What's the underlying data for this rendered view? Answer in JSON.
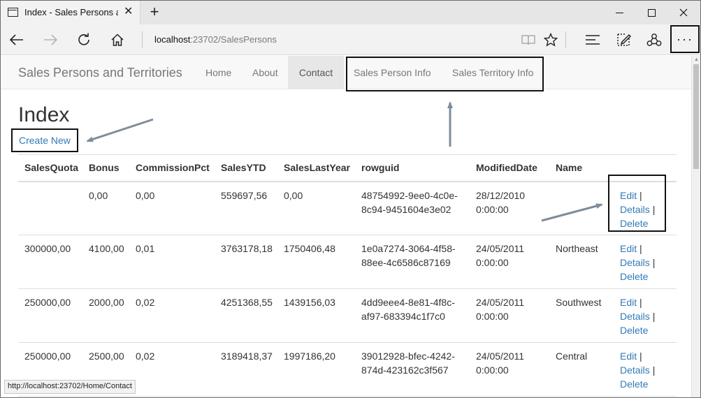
{
  "browser": {
    "tab_title": "Index - Sales Persons ar",
    "close_glyph": "✕",
    "new_tab_glyph": "+",
    "address_host": "localhost",
    "address_rest": ":23702/SalesPersons",
    "more_glyph": "···",
    "status_url": "http://localhost:23702/Home/Contact"
  },
  "nav": {
    "brand": "Sales Persons and Territories",
    "items": [
      "Home",
      "About",
      "Contact",
      "Sales Person Info",
      "Sales Territory Info"
    ],
    "active": "Contact"
  },
  "page": {
    "title": "Index",
    "create_new": "Create New"
  },
  "table": {
    "columns": [
      "SalesQuota",
      "Bonus",
      "CommissionPct",
      "SalesYTD",
      "SalesLastYear",
      "rowguid",
      "ModifiedDate",
      "Name",
      ""
    ],
    "rows": [
      {
        "quota": "",
        "bonus": "0,00",
        "pct": "0,00",
        "ytd": "559697,56",
        "last": "0,00",
        "guid1": "48754992-9ee0-4c0e-",
        "guid2": "8c94-9451604e3e02",
        "date1": "28/12/2010",
        "date2": "0:00:00",
        "name": ""
      },
      {
        "quota": "300000,00",
        "bonus": "4100,00",
        "pct": "0,01",
        "ytd": "3763178,18",
        "last": "1750406,48",
        "guid1": "1e0a7274-3064-4f58-",
        "guid2": "88ee-4c6586c87169",
        "date1": "24/05/2011",
        "date2": "0:00:00",
        "name": "Northeast"
      },
      {
        "quota": "250000,00",
        "bonus": "2000,00",
        "pct": "0,02",
        "ytd": "4251368,55",
        "last": "1439156,03",
        "guid1": "4dd9eee4-8e81-4f8c-",
        "guid2": "af97-683394c1f7c0",
        "date1": "24/05/2011",
        "date2": "0:00:00",
        "name": "Southwest"
      },
      {
        "quota": "250000,00",
        "bonus": "2500,00",
        "pct": "0,02",
        "ytd": "3189418,37",
        "last": "1997186,20",
        "guid1": "39012928-bfec-4242-",
        "guid2": "874d-423162c3f567",
        "date1": "24/05/2011",
        "date2": "0:00:00",
        "name": "Central"
      }
    ],
    "actions": {
      "edit": "Edit",
      "details": "Details",
      "delete": "Delete",
      "separator": "|"
    }
  },
  "colors": {
    "link": "#337ab7",
    "nav_text": "#777777",
    "annotation_arrow": "#7f8c99"
  }
}
